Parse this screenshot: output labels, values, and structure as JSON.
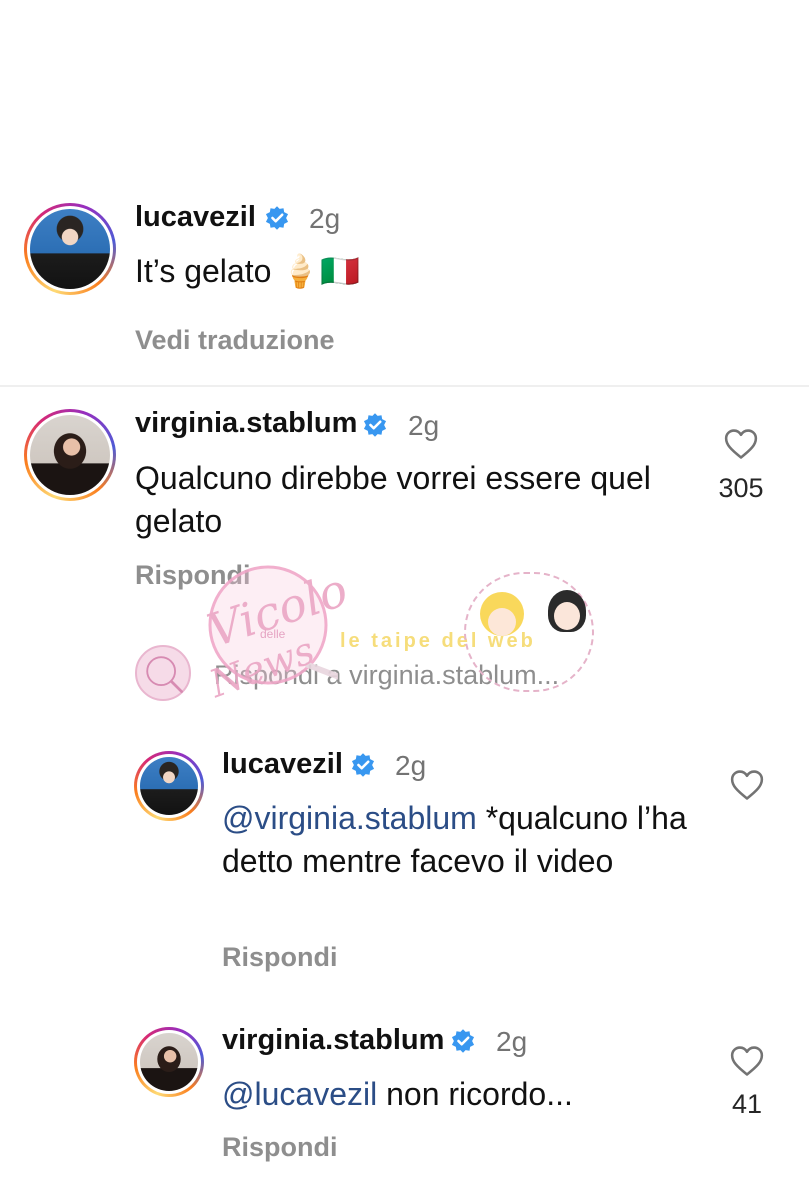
{
  "caption": {
    "username": "lucavezil",
    "time": "2g",
    "text": "It’s gelato 🍦🇮🇹",
    "translate_label": "Vedi traduzione"
  },
  "comments": [
    {
      "username": "virginia.stablum",
      "time": "2g",
      "text": "Qualcuno direbbe vorrei essere quel gelato",
      "reply_label": "Rispondi",
      "likes": "305"
    }
  ],
  "reply_box": {
    "placeholder": "Rispondi a virginia.stablum..."
  },
  "replies": [
    {
      "username": "lucavezil",
      "time": "2g",
      "mention": "@virginia.stablum",
      "text": " *qualcuno l’ha detto mentre facevo il video",
      "reply_label": "Rispondi"
    },
    {
      "username": "virginia.stablum",
      "time": "2g",
      "mention": "@lucavezil",
      "text": " non ricordo...",
      "reply_label": "Rispondi",
      "likes": "41"
    }
  ],
  "watermark": {
    "text_main": "Vicolo",
    "text_small": "delle",
    "text_script": "News",
    "text_badge": "le taipe del web"
  },
  "colors": {
    "verified": "#3897f0",
    "mention": "#2b4d86",
    "muted": "#8e8e8e"
  }
}
